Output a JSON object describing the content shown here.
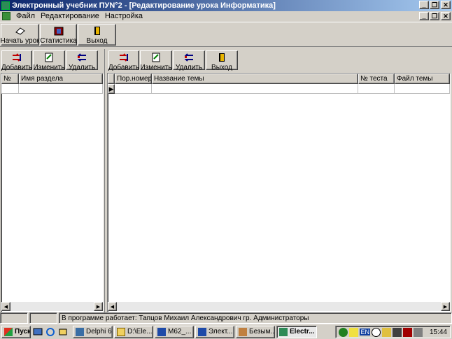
{
  "window": {
    "title": "Электронный учебник ПУN°2 - [Редактирование урока Информатика]"
  },
  "menu": {
    "items": [
      "Файл",
      "Редактирование",
      "Настройка"
    ]
  },
  "toolbar": {
    "start_label": "Начать урок",
    "stats_label": "Статистика",
    "exit_label": "Выход"
  },
  "left_panel": {
    "add_label": "Добавить",
    "edit_label": "Изменить",
    "delete_label": "Удалить",
    "columns": [
      "№",
      "Имя раздела"
    ]
  },
  "right_panel": {
    "add_label": "Добавить",
    "edit_label": "Изменить",
    "delete_label": "Удалить",
    "exit_label": "Выход",
    "columns": [
      "Пор.номер",
      "Название темы",
      "№ теста",
      "Файл темы"
    ]
  },
  "status": {
    "text": "В программе работает: Тапцов Михаил Александрович гр. Администраторы"
  },
  "taskbar": {
    "start_label": "Пуск",
    "tasks": [
      "Delphi 6",
      "D:\\Ele...",
      "M62_...",
      "Элект...",
      "Безым...",
      "Electr..."
    ],
    "lang": "EN",
    "clock": "15:44"
  },
  "colors": {
    "face": "#d4d0c8",
    "title_start": "#0a246a",
    "title_end": "#a6caf0"
  }
}
